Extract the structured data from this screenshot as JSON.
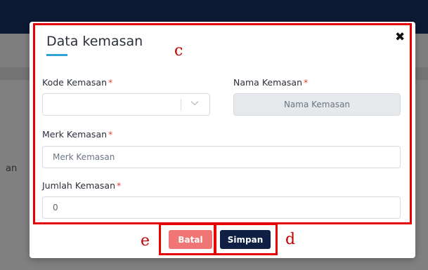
{
  "background": {
    "partial_text": "an"
  },
  "modal": {
    "title": "Data kemasan",
    "close_symbol": "✖",
    "fields": {
      "kode": {
        "label": "Kode Kemasan",
        "required_mark": "*",
        "value": ""
      },
      "nama": {
        "label": "Nama Kemasan",
        "required_mark": "*",
        "placeholder": "Nama Kemasan"
      },
      "merk": {
        "label": "Merk Kemasan",
        "required_mark": "*",
        "placeholder": "Merk Kemasan"
      },
      "jumlah": {
        "label": "Jumlah Kemasan",
        "required_mark": "*",
        "value": "0"
      }
    },
    "buttons": {
      "cancel": "Batal",
      "save": "Simpan"
    }
  },
  "annotations": {
    "c": "c",
    "d": "d",
    "e": "e"
  },
  "colors": {
    "cancel_button": "#f07575",
    "save_button": "#101f44",
    "title_accent": "#2fa3d6",
    "required_mark": "#e3412f",
    "annotation": "#e60000"
  }
}
